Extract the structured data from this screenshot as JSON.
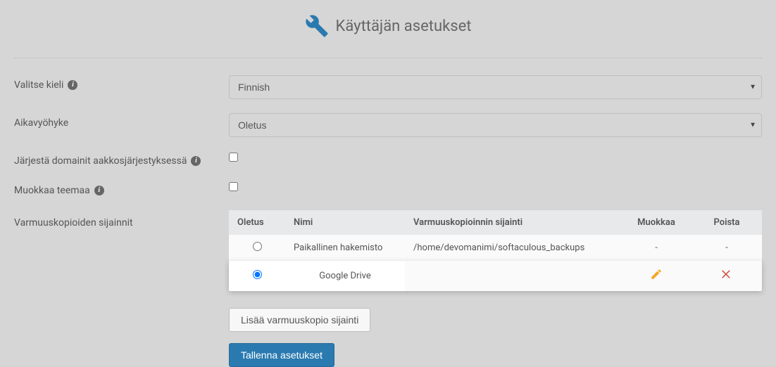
{
  "header": {
    "title": "Käyttäjän asetukset"
  },
  "form": {
    "language_label": "Valitse kieli",
    "language_value": "Finnish",
    "timezone_label": "Aikavyöhyke",
    "timezone_value": "Oletus",
    "sort_domains_label": "Järjestä domainit aakkosjärjestyksessä",
    "edit_theme_label": "Muokkaa teemaa",
    "backup_locations_label": "Varmuuskopioiden sijainnit"
  },
  "table": {
    "headers": {
      "default": "Oletus",
      "name": "Nimi",
      "location": "Varmuuskopioinnin sijainti",
      "edit": "Muokkaa",
      "delete": "Poista"
    },
    "rows": [
      {
        "selected": false,
        "name": "Paikallinen hakemisto",
        "location": "/home/devomanimi/softaculous_backups",
        "edit": "-",
        "delete": "-"
      },
      {
        "selected": true,
        "name": "Google Drive",
        "location": "",
        "edit": "pencil",
        "delete": "x"
      }
    ]
  },
  "buttons": {
    "add_location": "Lisää varmuuskopio sijainti",
    "save": "Tallenna asetukset"
  },
  "icons": {
    "info": "i"
  }
}
